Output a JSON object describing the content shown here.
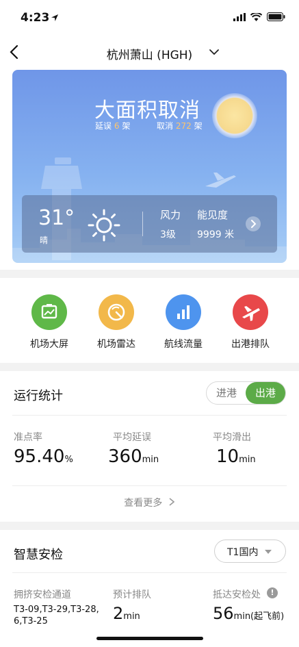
{
  "status_bar": {
    "time": "4:23"
  },
  "nav": {
    "title": "杭州萧山 (HGH)"
  },
  "hero": {
    "status": "大面积取消",
    "delay_label": "延误",
    "delay_count": "6",
    "delay_unit": "架",
    "cancel_label": "取消",
    "cancel_count": "272",
    "cancel_unit": "架"
  },
  "weather": {
    "temperature": "31°",
    "condition": "晴",
    "wind_label": "风力",
    "wind_value": "3级",
    "visibility_label": "能见度",
    "visibility_value": "9999 米"
  },
  "shortcuts": [
    {
      "label": "机场大屏",
      "color": "#5fb848"
    },
    {
      "label": "机场雷达",
      "color": "#f2b84a"
    },
    {
      "label": "航线流量",
      "color": "#4e94ee"
    },
    {
      "label": "出港排队",
      "color": "#e8484a"
    }
  ],
  "stats": {
    "title": "运行统计",
    "toggle_in": "进港",
    "toggle_out": "出港",
    "on_time_label": "准点率",
    "on_time_value": "95.40",
    "on_time_unit": "%",
    "avg_delay_label": "平均延误",
    "avg_delay_value": "360",
    "avg_delay_unit": "min",
    "avg_taxi_label": "平均滑出",
    "avg_taxi_value": "10",
    "avg_taxi_unit": "min",
    "more": "查看更多"
  },
  "security": {
    "title": "智慧安检",
    "terminal": "T1国内",
    "congested_label": "拥挤安检通道",
    "congested_value": "T3-09,T3-29,T3-28,6,T3-25",
    "queue_label": "预计排队",
    "queue_value": "2",
    "queue_unit": "min",
    "arrive_label": "抵达安检处",
    "arrive_value": "56",
    "arrive_unit": "min(起飞前)"
  }
}
